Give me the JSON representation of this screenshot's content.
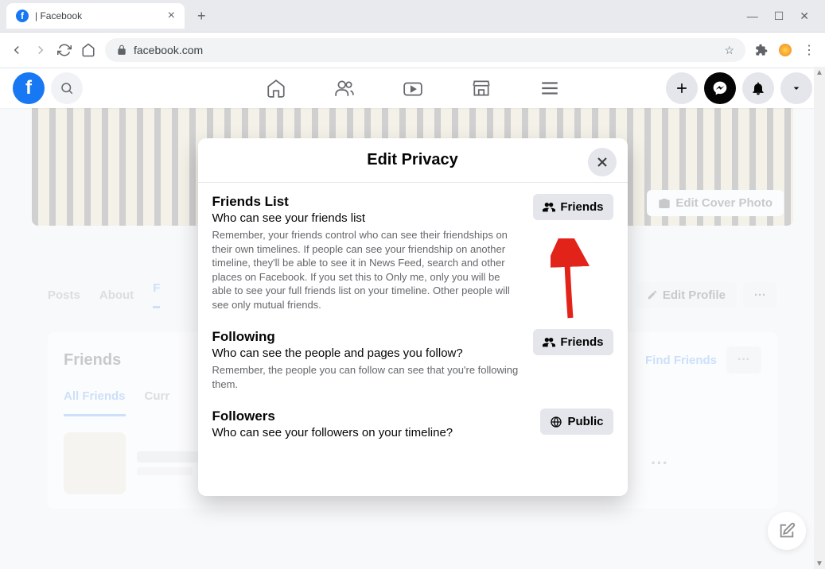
{
  "browser": {
    "tab_title": "| Facebook",
    "url_host": "facebook.com"
  },
  "cover": {
    "edit_label": "Edit Cover Photo"
  },
  "profile_nav": {
    "posts": "Posts",
    "about": "About",
    "friends": "F",
    "edit_profile": "Edit Profile"
  },
  "friends_card": {
    "title": "Friends",
    "find": "Find Friends",
    "tab_all": "All Friends",
    "tab_cur": "Curr"
  },
  "modal": {
    "title": "Edit Privacy",
    "sections": [
      {
        "heading": "Friends List",
        "sub": "Who can see your friends list",
        "detail": "Remember, your friends control who can see their friendships on their own timelines. If people can see your friendship on another timeline, they'll be able to see it in News Feed, search and other places on Facebook. If you set this to Only me, only you will be able to see your full friends list on your timeline. Other people will see only mutual friends.",
        "btn": "Friends",
        "icon": "friends"
      },
      {
        "heading": "Following",
        "sub": "Who can see the people and pages you follow?",
        "detail": "Remember, the people you can follow can see that you're following them.",
        "btn": "Friends",
        "icon": "friends"
      },
      {
        "heading": "Followers",
        "sub": "Who can see your followers on your timeline?",
        "detail": "",
        "btn": "Public",
        "icon": "globe"
      }
    ]
  }
}
